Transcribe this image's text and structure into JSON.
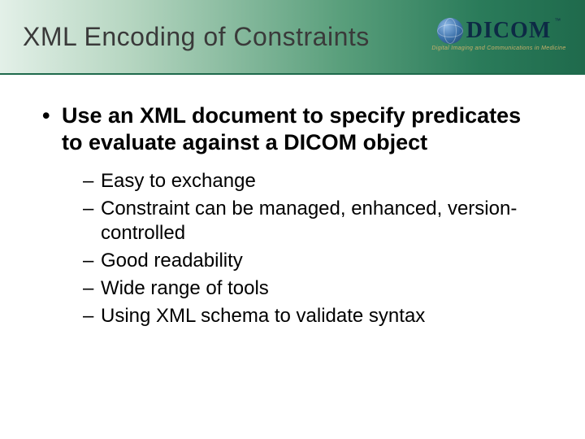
{
  "header": {
    "title": "XML Encoding of Constraints",
    "logo": {
      "name": "DICOM",
      "subtitle": "Digital Imaging and Communications in Medicine"
    }
  },
  "content": {
    "main_bullet": "Use an XML document to specify predicates to evaluate against a DICOM object",
    "sub_bullets": [
      "Easy to exchange",
      "Constraint can be managed, enhanced, version-controlled",
      "Good readability",
      "Wide range of tools",
      "Using XML schema to validate syntax"
    ]
  }
}
